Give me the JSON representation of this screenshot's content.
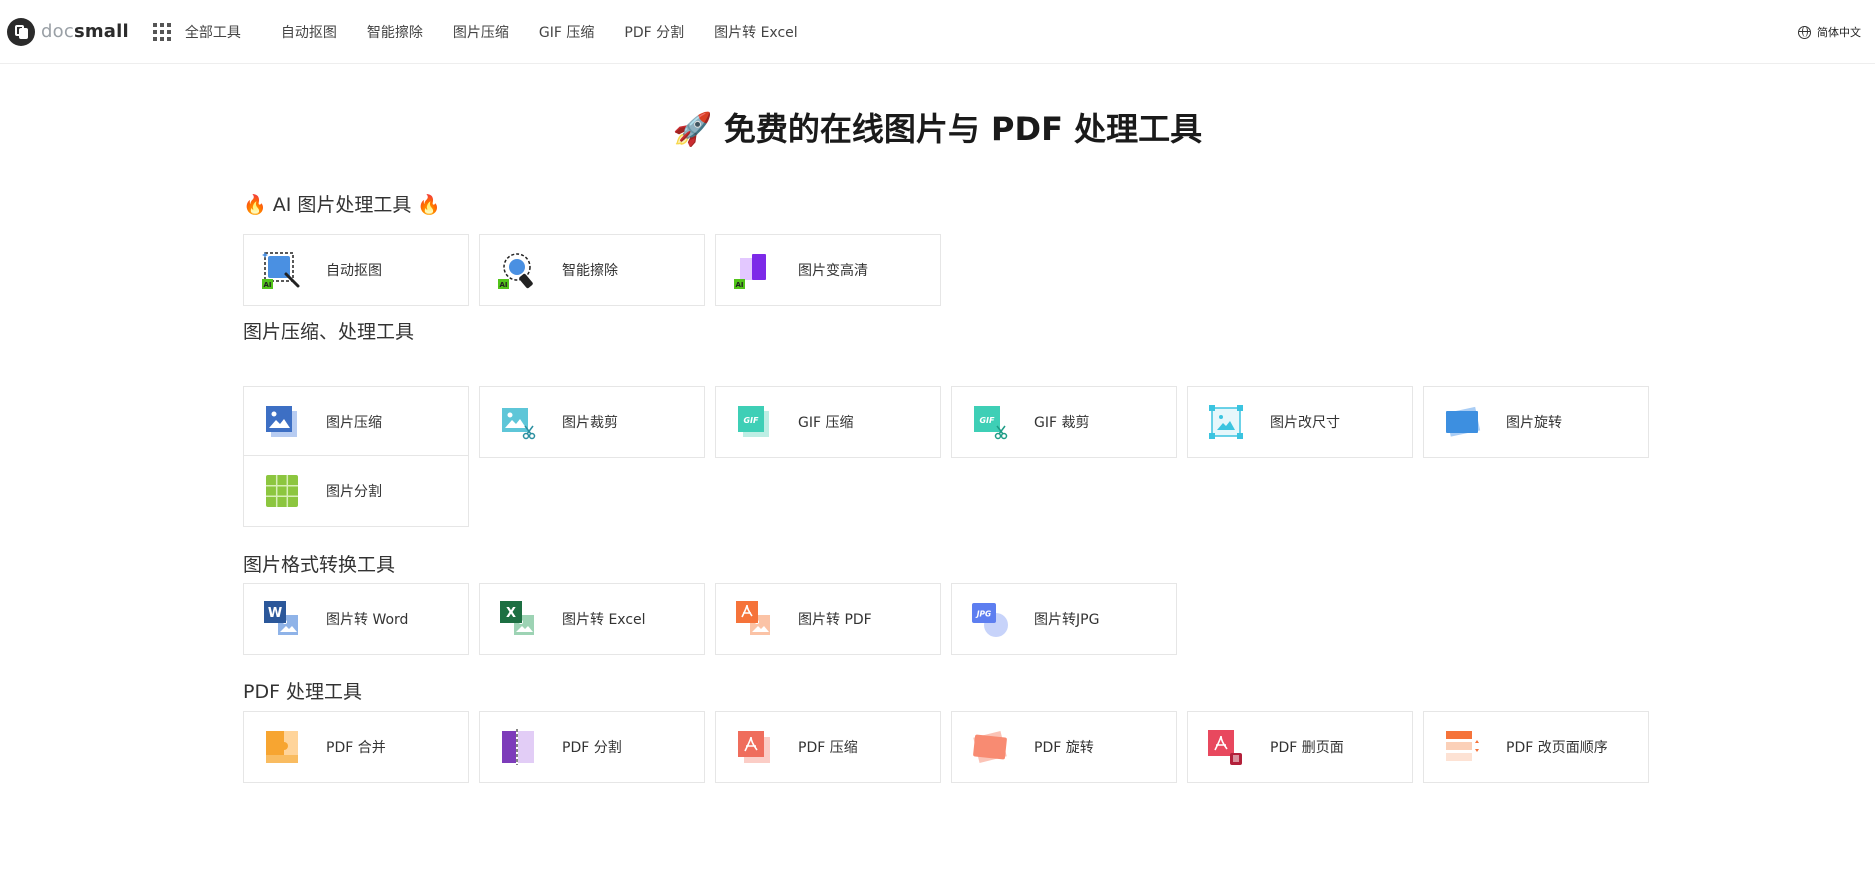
{
  "header": {
    "logo_part1": "doc",
    "logo_part2": "small",
    "all_tools": "全部工具",
    "nav": [
      "自动抠图",
      "智能擦除",
      "图片压缩",
      "GIF 压缩",
      "PDF 分割",
      "图片转 Excel"
    ],
    "language": "简体中文"
  },
  "page": {
    "title": "🚀 免费的在线图片与 PDF 处理工具"
  },
  "sections": [
    {
      "title": "🔥 AI 图片处理工具 🔥",
      "tools": [
        {
          "label": "自动抠图",
          "icon": "ai-cutout-icon"
        },
        {
          "label": "智能擦除",
          "icon": "ai-erase-icon"
        },
        {
          "label": "图片变高清",
          "icon": "ai-enhance-icon"
        }
      ]
    },
    {
      "title": "图片压缩、处理工具",
      "tools": [
        {
          "label": "图片压缩",
          "icon": "image-compress-icon"
        },
        {
          "label": "图片裁剪",
          "icon": "image-crop-icon"
        },
        {
          "label": "GIF 压缩",
          "icon": "gif-compress-icon"
        },
        {
          "label": "GIF 裁剪",
          "icon": "gif-crop-icon"
        },
        {
          "label": "图片改尺寸",
          "icon": "image-resize-icon"
        },
        {
          "label": "图片旋转",
          "icon": "image-rotate-icon"
        },
        {
          "label": "图片分割",
          "icon": "image-split-icon"
        }
      ]
    },
    {
      "title": "图片格式转换工具",
      "tools": [
        {
          "label": "图片转 Word",
          "icon": "image-to-word-icon"
        },
        {
          "label": "图片转 Excel",
          "icon": "image-to-excel-icon"
        },
        {
          "label": "图片转 PDF",
          "icon": "image-to-pdf-icon"
        },
        {
          "label": "图片转JPG",
          "icon": "image-to-jpg-icon"
        }
      ]
    },
    {
      "title": "PDF 处理工具",
      "tools": [
        {
          "label": "PDF 合并",
          "icon": "pdf-merge-icon"
        },
        {
          "label": "PDF 分割",
          "icon": "pdf-split-icon"
        },
        {
          "label": "PDF 压缩",
          "icon": "pdf-compress-icon"
        },
        {
          "label": "PDF 旋转",
          "icon": "pdf-rotate-icon"
        },
        {
          "label": "PDF 删页面",
          "icon": "pdf-delete-page-icon"
        },
        {
          "label": "PDF 改页面顺序",
          "icon": "pdf-reorder-icon"
        }
      ]
    }
  ],
  "icon_text": {
    "ai": "AI",
    "gif": "GIF",
    "word": "W",
    "excel": "X",
    "jpg": "JPG"
  },
  "colors": {
    "ai_badge": "#52c41a",
    "image_blue": "#3d6fc4",
    "gif_teal": "#3ecfb6",
    "word": "#2b579a",
    "excel": "#1d6f42",
    "pdf_orange": "#f5733a",
    "jpg": "#5d7ef0",
    "split_green": "#8cc63f"
  }
}
